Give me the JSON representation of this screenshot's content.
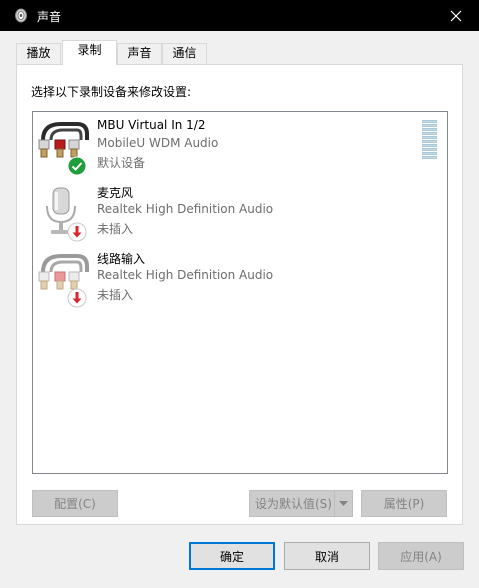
{
  "window": {
    "title": "声音",
    "close_glyph": "✕"
  },
  "tabs": [
    {
      "label": "播放"
    },
    {
      "label": "录制"
    },
    {
      "label": "声音"
    },
    {
      "label": "通信"
    }
  ],
  "panel": {
    "instruction": "选择以下录制设备来修改设置:",
    "devices": [
      {
        "name": "MBU Virtual In 1/2",
        "driver": "MobileU WDM Audio",
        "status": "默认设备",
        "badge": "check-icon",
        "icon": "rca-cable-icon"
      },
      {
        "name": "麦克风",
        "driver": "Realtek High Definition Audio",
        "status": "未插入",
        "badge": "unplugged-arrow-icon",
        "icon": "microphone-icon"
      },
      {
        "name": "线路输入",
        "driver": "Realtek High Definition Audio",
        "status": "未插入",
        "badge": "unplugged-arrow-icon",
        "icon": "rca-cable-icon"
      }
    ],
    "buttons": {
      "configure": "配置(C)",
      "set_default": "设为默认值(S)",
      "properties": "属性(P)"
    }
  },
  "footer": {
    "ok": "确定",
    "cancel": "取消",
    "apply": "应用(A)"
  },
  "colors": {
    "accent": "#0078d7",
    "check_green": "#1e9e3c",
    "unplugged_red": "#d9262b"
  }
}
